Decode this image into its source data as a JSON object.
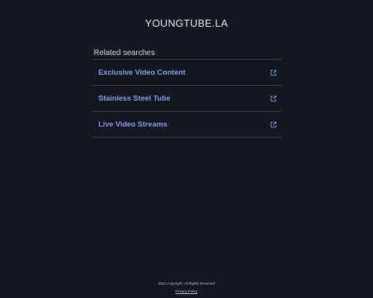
{
  "site": {
    "title": "YOUNGTUBE.LA"
  },
  "related": {
    "heading": "Related searches",
    "items": [
      {
        "label": "Exclusive Video Content",
        "icon": "external-link-icon"
      },
      {
        "label": "Stainless Steel Tube",
        "icon": "external-link-icon"
      },
      {
        "label": "Live Video Streams",
        "icon": "external-link-icon"
      }
    ]
  },
  "footer": {
    "copyright": "2024 Copyright. All Rights Reserved",
    "privacy_label": "Privacy Policy"
  },
  "colors": {
    "background": "#141720",
    "link": "#7ea1e6",
    "divider": "#353a48"
  }
}
